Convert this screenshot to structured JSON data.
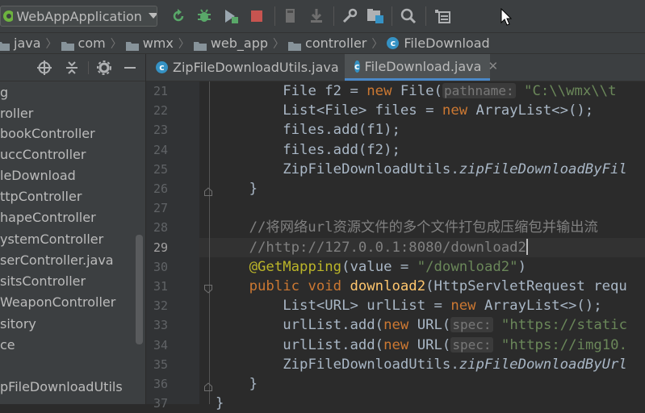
{
  "toolbar": {
    "run_config": "WebAppApplication",
    "icons": [
      "rerun-icon",
      "debug-icon",
      "coverage-icon",
      "stop-icon",
      "build-icon",
      "build-artifacts-icon",
      "settings-icon",
      "project-structure-icon",
      "search-icon",
      "layout-icon"
    ]
  },
  "breadcrumb": {
    "items": [
      {
        "label": "java",
        "kind": "folder"
      },
      {
        "label": "com",
        "kind": "folder"
      },
      {
        "label": "wmx",
        "kind": "folder"
      },
      {
        "label": "web_app",
        "kind": "folder"
      },
      {
        "label": "controller",
        "kind": "folder"
      },
      {
        "label": "FileDownload",
        "kind": "class"
      }
    ]
  },
  "project_tree": {
    "items": [
      {
        "label": "g"
      },
      {
        "label": "roller"
      },
      {
        "label": "bookController"
      },
      {
        "label": "uccController"
      },
      {
        "label": "leDownload"
      },
      {
        "label": "ttpController"
      },
      {
        "label": "hapeController"
      },
      {
        "label": "ystemController"
      },
      {
        "label": "serController.java"
      },
      {
        "label": "sitsController"
      },
      {
        "label": "Weapon​Controller"
      },
      {
        "label": "sitory"
      },
      {
        "label": "ce"
      },
      {
        "label": ""
      },
      {
        "label": "pFileDownloadUtils"
      }
    ]
  },
  "tabs": [
    {
      "label": "ZipFileDownloadUtils.java",
      "active": false
    },
    {
      "label": "FileDownload.java",
      "active": true
    }
  ],
  "editor": {
    "current_line": "29",
    "lines": [
      {
        "n": "21",
        "tokens": [
          {
            "t": "        File f2 = ",
            "c": "plain"
          },
          {
            "t": "new ",
            "c": "kw"
          },
          {
            "t": "File(",
            "c": "plain"
          },
          {
            "t": "pathname:",
            "c": "hint"
          },
          {
            "t": " \"C:\\\\wmx\\\\t",
            "c": "str"
          }
        ]
      },
      {
        "n": "22",
        "tokens": [
          {
            "t": "        List<File> files = ",
            "c": "plain"
          },
          {
            "t": "new ",
            "c": "kw"
          },
          {
            "t": "ArrayList<>();",
            "c": "plain"
          }
        ]
      },
      {
        "n": "23",
        "tokens": [
          {
            "t": "        files.add(f1);",
            "c": "plain"
          }
        ]
      },
      {
        "n": "24",
        "tokens": [
          {
            "t": "        files.add(f2);",
            "c": "plain"
          }
        ]
      },
      {
        "n": "25",
        "tokens": [
          {
            "t": "        ZipFileDownloadUtils.",
            "c": "plain"
          },
          {
            "t": "zipFileDownloadByFil",
            "c": "it"
          }
        ]
      },
      {
        "n": "26",
        "tokens": [
          {
            "t": "    }",
            "c": "plain"
          }
        ]
      },
      {
        "n": "27",
        "tokens": []
      },
      {
        "n": "28",
        "tokens": [
          {
            "t": "    //将网络url资源文件的多个文件打包成压缩包并输出流",
            "c": "cm"
          }
        ]
      },
      {
        "n": "29",
        "tokens": [
          {
            "t": "    //http://127.0.0.1:8080/download2",
            "c": "cm"
          }
        ]
      },
      {
        "n": "30",
        "tokens": [
          {
            "t": "    @GetMapping",
            "c": "ann"
          },
          {
            "t": "(value = ",
            "c": "plain"
          },
          {
            "t": "\"/download2\"",
            "c": "str"
          },
          {
            "t": ")",
            "c": "plain"
          }
        ]
      },
      {
        "n": "31",
        "tokens": [
          {
            "t": "    public void ",
            "c": "kw"
          },
          {
            "t": "download2",
            "c": "fn"
          },
          {
            "t": "(HttpServletRequest requ",
            "c": "plain"
          }
        ]
      },
      {
        "n": "32",
        "tokens": [
          {
            "t": "        List<URL> urlList = ",
            "c": "plain"
          },
          {
            "t": "new ",
            "c": "kw"
          },
          {
            "t": "ArrayList<>();",
            "c": "plain"
          }
        ]
      },
      {
        "n": "33",
        "tokens": [
          {
            "t": "        urlList.add(",
            "c": "plain"
          },
          {
            "t": "new ",
            "c": "kw"
          },
          {
            "t": "URL(",
            "c": "plain"
          },
          {
            "t": "spec:",
            "c": "hint"
          },
          {
            "t": " \"https://static",
            "c": "str"
          }
        ]
      },
      {
        "n": "34",
        "tokens": [
          {
            "t": "        urlList.add(",
            "c": "plain"
          },
          {
            "t": "new ",
            "c": "kw"
          },
          {
            "t": "URL(",
            "c": "plain"
          },
          {
            "t": "spec:",
            "c": "hint"
          },
          {
            "t": " \"https://img10.",
            "c": "str"
          }
        ]
      },
      {
        "n": "35",
        "tokens": [
          {
            "t": "        ZipFileDownloadUtils.",
            "c": "plain"
          },
          {
            "t": "zipFileDownloadByUrl",
            "c": "it"
          }
        ]
      },
      {
        "n": "36",
        "tokens": [
          {
            "t": "    }",
            "c": "plain"
          }
        ]
      },
      {
        "n": "37",
        "tokens": [
          {
            "t": "}",
            "c": "plain"
          }
        ]
      }
    ]
  }
}
